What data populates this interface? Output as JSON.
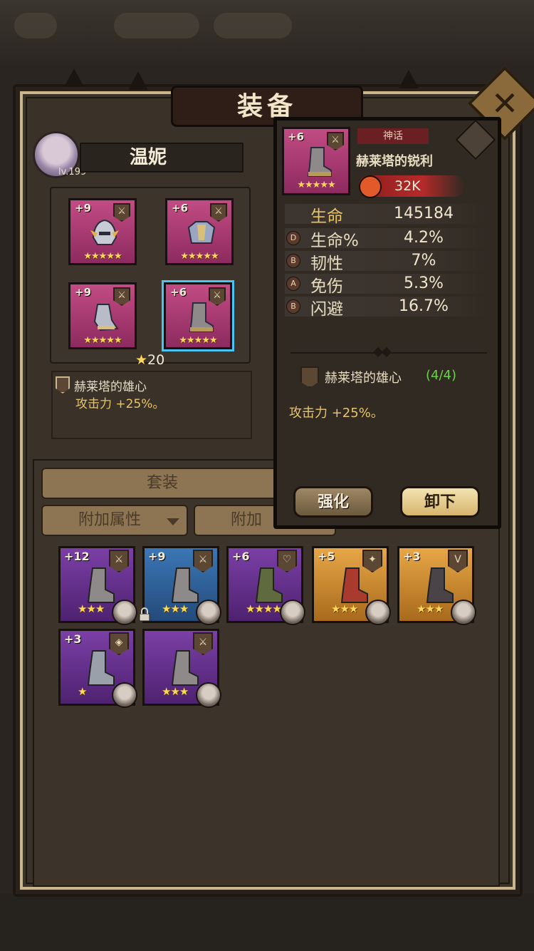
{
  "title": "装备",
  "hero": {
    "name": "温妮",
    "level": "lv.199"
  },
  "equipped_slots": [
    {
      "plus": "+9",
      "stars": "★★★★★"
    },
    {
      "plus": "+6",
      "stars": "★★★★★"
    },
    {
      "plus": "+9",
      "stars": "★★★★★"
    },
    {
      "plus": "+6",
      "stars": "★★★★★",
      "selected": true
    }
  ],
  "star_total": "20",
  "set_bonus": {
    "name": "赫莱塔的雄心",
    "effect": "攻击力 +25%。"
  },
  "tabs": {
    "set": "套装",
    "filter1": "附加属性",
    "filter2": "附加"
  },
  "inventory": [
    {
      "plus": "+12",
      "stars": "★★★",
      "color": "purple",
      "badge": "sword"
    },
    {
      "plus": "+9",
      "stars": "★★★",
      "color": "blue",
      "badge": "sword",
      "locked": true
    },
    {
      "plus": "+6",
      "stars": "★★★★",
      "color": "purple",
      "badge": "heart"
    },
    {
      "plus": "+5",
      "stars": "★★★",
      "color": "orange",
      "badge": "compass"
    },
    {
      "plus": "+3",
      "stars": "★★★",
      "color": "orange",
      "badge": "horns"
    },
    {
      "plus": "+3",
      "stars": "★",
      "color": "purple",
      "badge": "diamond"
    },
    {
      "plus": "",
      "stars": "★★★",
      "color": "purple",
      "badge": "sword"
    }
  ],
  "popup": {
    "item_plus": "+6",
    "item_stars": "★★★★★",
    "rarity": "神话",
    "item_name": "赫莱塔的锐利",
    "power": "32K",
    "stats": [
      {
        "grade": "",
        "name": "生命",
        "value": "145184",
        "main": true
      },
      {
        "grade": "D",
        "name": "生命%",
        "value": "4.2%"
      },
      {
        "grade": "B",
        "name": "韧性",
        "value": "7%"
      },
      {
        "grade": "A",
        "name": "免伤",
        "value": "5.3%"
      },
      {
        "grade": "B",
        "name": "闪避",
        "value": "16.7%"
      }
    ],
    "set_name": "赫莱塔的雄心",
    "set_count": "(4/4)",
    "set_effect": "攻击力 +25%。",
    "strengthen_label": "强化",
    "unequip_label": "卸下"
  },
  "colors": {
    "rarity_mythic": "#c24c84",
    "selected_outline": "#4bc4f2",
    "set_complete": "#6ad24a",
    "effect_text": "#e7c36a"
  }
}
